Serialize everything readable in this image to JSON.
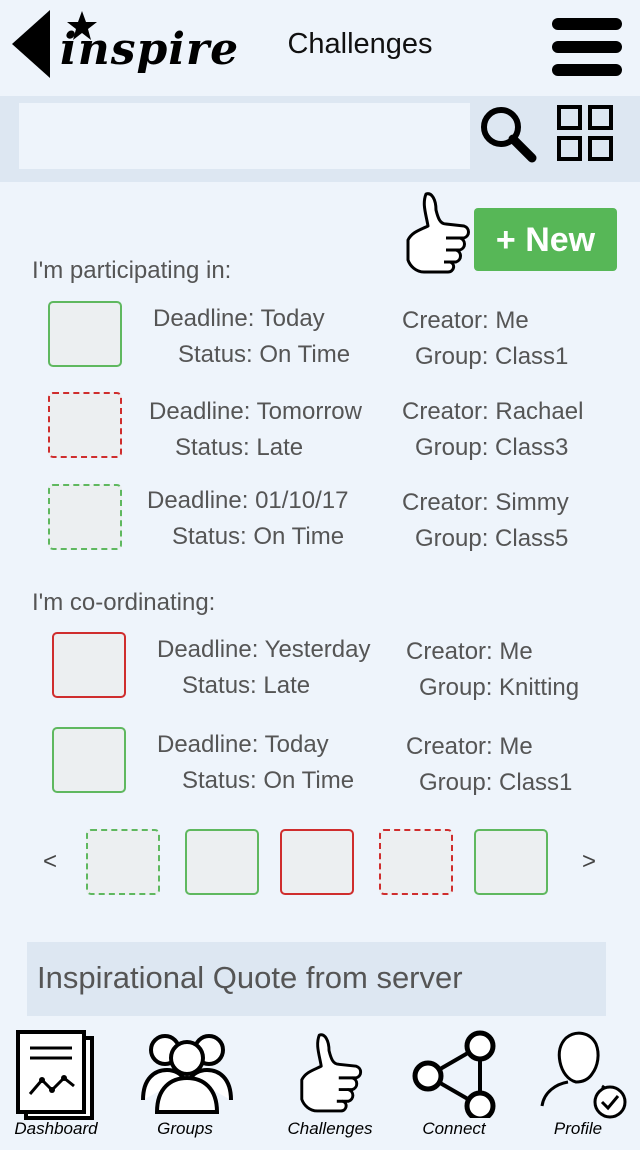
{
  "header": {
    "logo_text": "inspire",
    "title": "Challenges"
  },
  "search": {
    "placeholder": ""
  },
  "new_button_label": "+ New",
  "participating": {
    "heading": "I'm participating in:",
    "items": [
      {
        "deadline": "Deadline: Today",
        "status": "Status: On Time",
        "creator": "Creator: Me",
        "group": "Group: Class1",
        "style": "solid-green"
      },
      {
        "deadline": "Deadline: Tomorrow",
        "status": "Status: Late",
        "creator": "Creator: Rachael",
        "group": "Group: Class3",
        "style": "dashed-red"
      },
      {
        "deadline": "Deadline: 01/10/17",
        "status": "Status: On Time",
        "creator": "Creator: Simmy",
        "group": "Group: Class5",
        "style": "dashed-green"
      }
    ]
  },
  "coordinating": {
    "heading": "I'm co-ordinating:",
    "items": [
      {
        "deadline": "Deadline: Yesterday",
        "status": "Status: Late",
        "creator": "Creator: Me",
        "group": "Group: Knitting",
        "style": "solid-red"
      },
      {
        "deadline": "Deadline: Today",
        "status": "Status: On Time",
        "creator": "Creator: Me",
        "group": "Group: Class1",
        "style": "solid-green"
      }
    ]
  },
  "carousel": {
    "prev": "<",
    "next": ">",
    "items": [
      "dashed-green",
      "solid-green",
      "solid-red",
      "dashed-red",
      "solid-green"
    ]
  },
  "quote": "Inspirational Quote from server",
  "nav": [
    {
      "label": "Dashboard",
      "icon": "dashboard-icon"
    },
    {
      "label": "Groups",
      "icon": "groups-icon"
    },
    {
      "label": "Challenges",
      "icon": "thumbs-up-icon"
    },
    {
      "label": "Connect",
      "icon": "share-icon"
    },
    {
      "label": "Profile",
      "icon": "profile-check-icon"
    }
  ],
  "colors": {
    "accent_green": "#57b757",
    "late_red": "#cf2d2d",
    "background": "#eef4fb"
  }
}
